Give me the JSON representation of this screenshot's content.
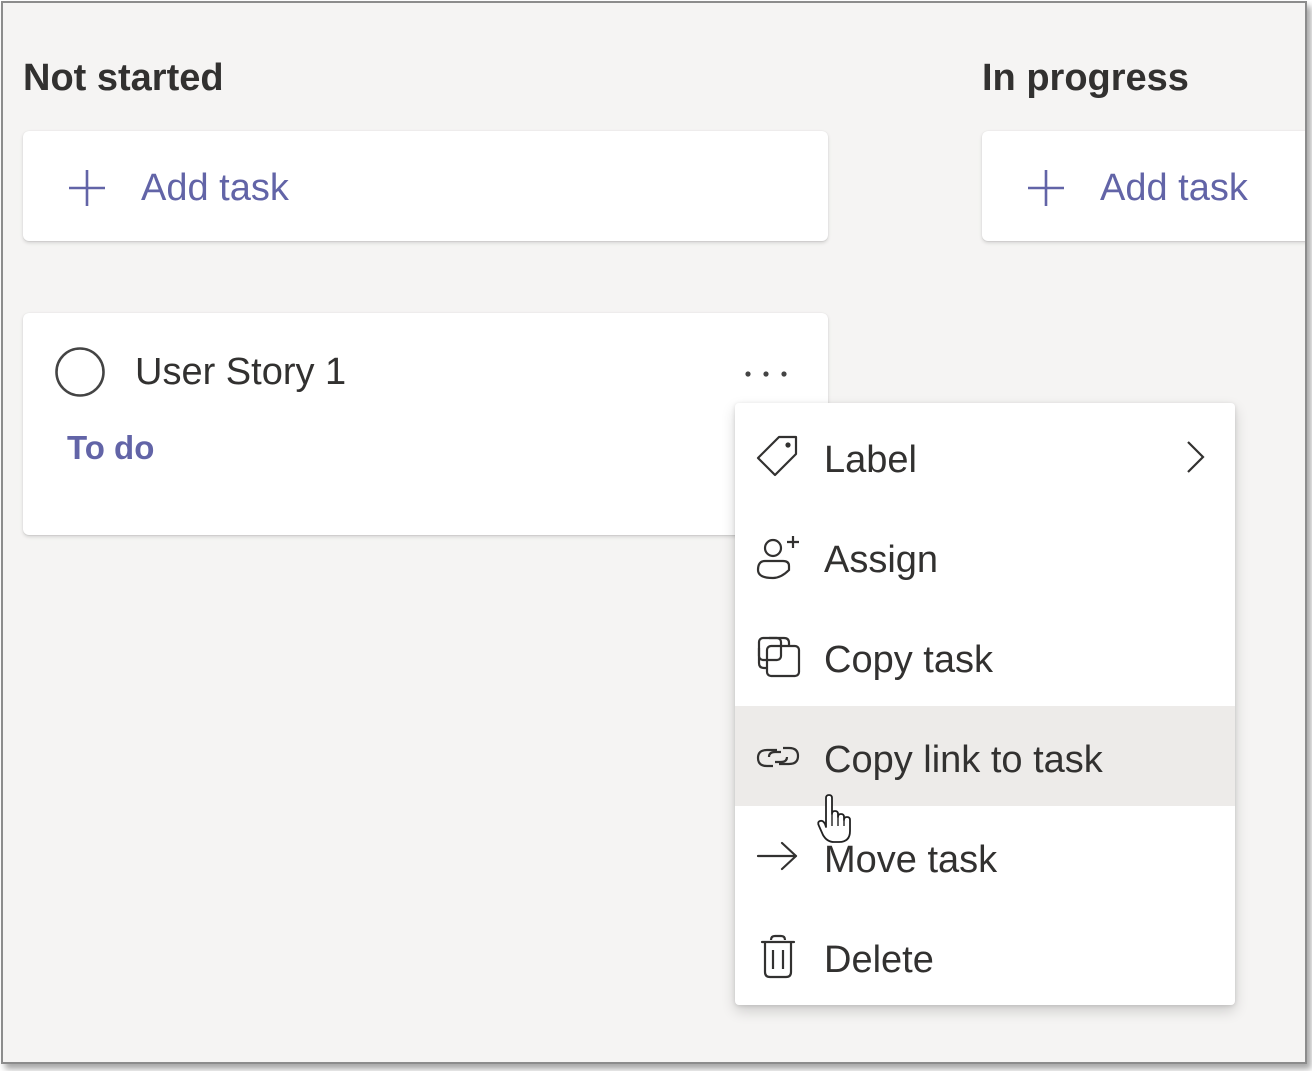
{
  "board": {
    "columns": [
      {
        "title": "Not started",
        "add_task_label": "Add task"
      },
      {
        "title": "In progress",
        "add_task_label": "Add task"
      }
    ]
  },
  "task": {
    "title": "User Story 1",
    "bucket": "To do"
  },
  "context_menu": {
    "items": [
      {
        "label": "Label",
        "icon": "tag-icon",
        "has_submenu": true
      },
      {
        "label": "Assign",
        "icon": "person-add-icon"
      },
      {
        "label": "Copy task",
        "icon": "copy-icon"
      },
      {
        "label": "Copy link to task",
        "icon": "link-icon",
        "hovered": true
      },
      {
        "label": "Move task",
        "icon": "arrow-right-icon"
      },
      {
        "label": "Delete",
        "icon": "trash-icon"
      }
    ]
  },
  "colors": {
    "accent": "#6264a7",
    "text": "#323130",
    "background": "#f5f4f3",
    "hover": "#edebe9"
  }
}
